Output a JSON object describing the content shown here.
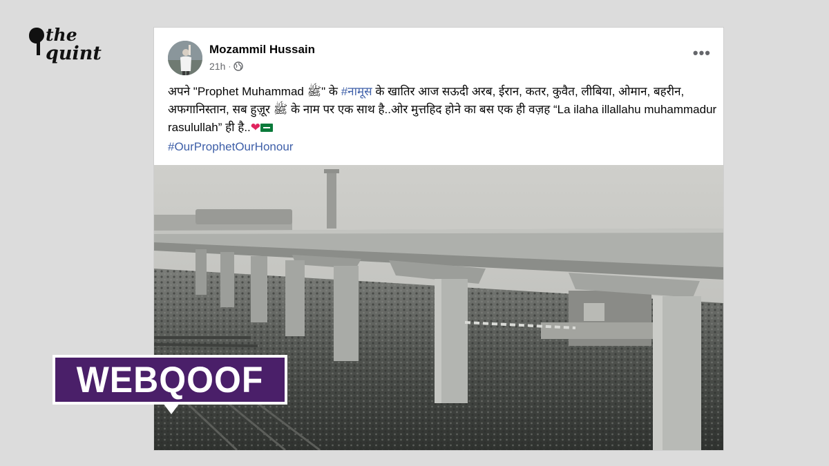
{
  "brand": {
    "logo_line1": "the",
    "logo_line2": "quint"
  },
  "post": {
    "author": "Mozammil Hussain",
    "time": "21h",
    "dot": "·",
    "more_label": "•••",
    "body": {
      "p1": "अपने \"Prophet Muhammad ﷺ\"  के ",
      "tag1": "#नामूस",
      "p2": " के खातिर आज सऊदी अरब,  ईरान, कतर, कुवैत, लीबिया, ओमान, बहरीन, अफगानिस्तान, सब हुज़ूर ﷺ के नाम पर एक साथ है..ओर  मुत्तहिद होने का बस एक ही वज़ह “La ilaha illallahu muhammadur rasulullah” ही है..",
      "heart": "❤"
    },
    "hashtag": "#OurProphetOurHonour"
  },
  "badge": {
    "label": "WEBQOOF"
  },
  "colors": {
    "link": "#3e5fa8",
    "badge_bg": "#4a1f69",
    "page_bg": "#dcdcdc"
  },
  "icons": [
    "quote-logo-icon",
    "globe-icon",
    "more-options-icon",
    "saudi-flag-icon",
    "red-heart-icon"
  ]
}
